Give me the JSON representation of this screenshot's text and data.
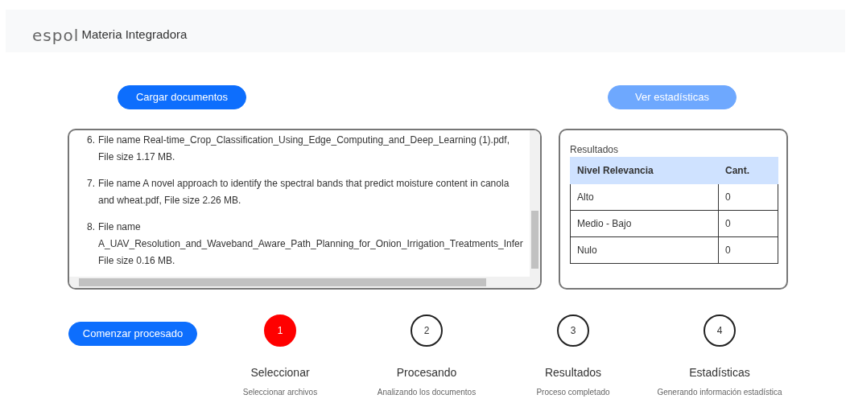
{
  "navbar": {
    "logo": "espol",
    "title": "Materia Integradora"
  },
  "buttons": {
    "upload": {
      "label": "Cargar documentos",
      "disabled": false
    },
    "stats": {
      "label": "Ver estadísticas",
      "disabled": true
    },
    "start": {
      "label": "Comenzar procesado",
      "disabled": false
    }
  },
  "files": [
    {
      "number": "6.",
      "text": "File name Real-time_Crop_Classification_Using_Edge_Computing_and_Deep_Learning (1).pdf, File size 1.17 MB."
    },
    {
      "number": "7.",
      "text": "File name A novel approach to identify the spectral bands that predict moisture content in canola and wheat.pdf, File size 2.26 MB."
    },
    {
      "number": "8.",
      "text": "File name A_UAV_Resolution_and_Waveband_Aware_Path_Planning_for_Onion_Irrigation_Treatments_Infer File size 0.16 MB."
    }
  ],
  "results": {
    "caption": "Resultados",
    "columns": [
      "Nivel Relevancia",
      "Cant."
    ],
    "rows": [
      [
        "Alto",
        "0"
      ],
      [
        "Medio - Bajo",
        "0"
      ],
      [
        "Nulo",
        "0"
      ]
    ]
  },
  "steps": [
    {
      "number": "1",
      "title": "Seleccionar",
      "subtitle": "Seleccionar archivos",
      "selected": true
    },
    {
      "number": "2",
      "title": "Procesando",
      "subtitle": "Analizando los documentos",
      "selected": false
    },
    {
      "number": "3",
      "title": "Resultados",
      "subtitle": "Proceso completado",
      "selected": false
    },
    {
      "number": "4",
      "title": "Estadísticas",
      "subtitle": "Generando información estadística",
      "selected": false
    }
  ]
}
